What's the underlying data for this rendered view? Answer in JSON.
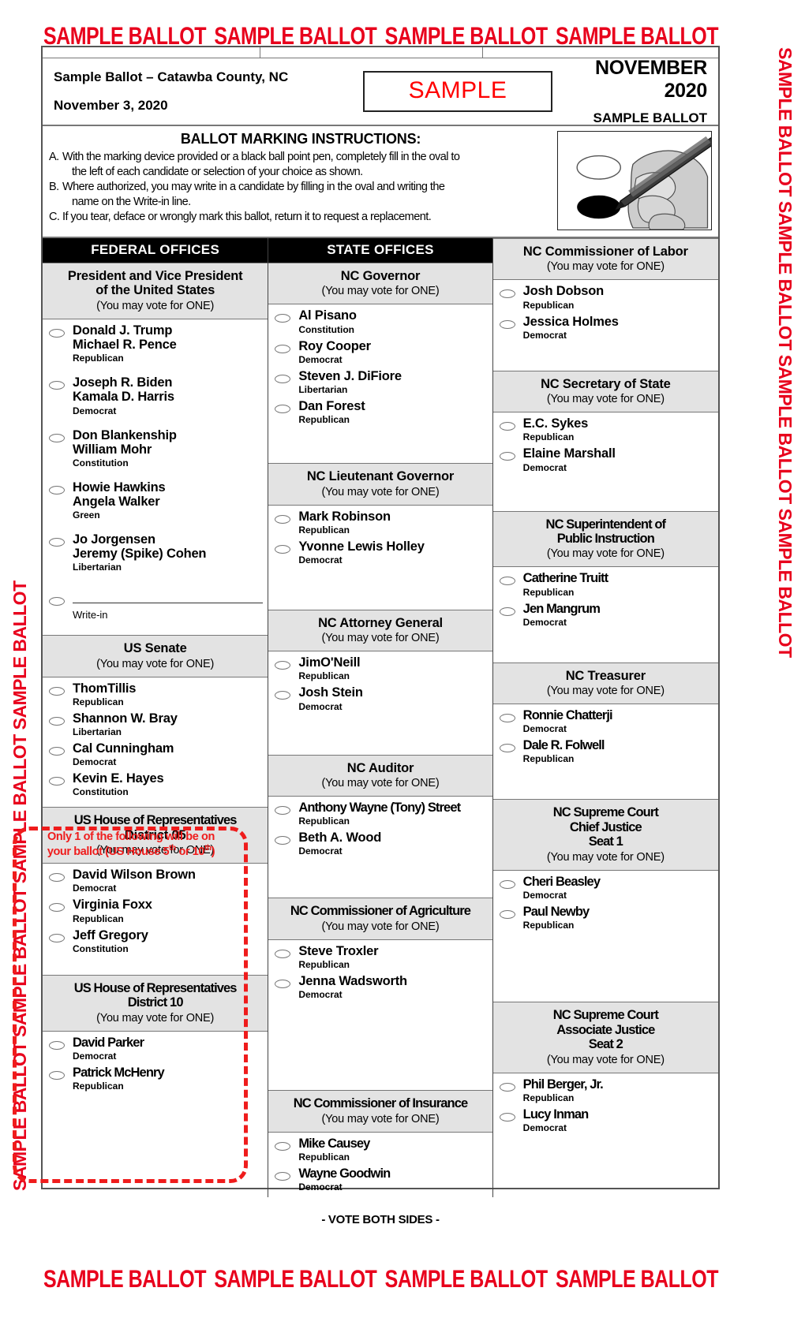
{
  "watermark": {
    "text": "SAMPLE BALLOT",
    "top_repeats": 4,
    "bottom_repeats": 4,
    "side_left": "SAMPLE BALLOT SAMPLE BALLOT SAMPLE BALLOT SAMPLE BALLOT",
    "side_right": "SAMPLE BALLOT SAMPLE BALLOT SAMPLE BALLOT SAMPLE BALLOT",
    "color": "#e8001c"
  },
  "header": {
    "title": "Sample Ballot – Catawba County, NC",
    "date": "November 3, 2020",
    "stamp": "SAMPLE",
    "stamp_color": "#ff0000",
    "right_month": "NOVEMBER 2020",
    "right_sub": "SAMPLE BALLOT"
  },
  "instructions": {
    "title": "BALLOT MARKING INSTRUCTIONS:",
    "items": [
      {
        "label": "A.",
        "line1": "With the marking device provided or a black ball point pen, completely fill in the oval to",
        "line2": "the left of each candidate or selection of your choice as shown."
      },
      {
        "label": "B.",
        "line1": "Where authorized, you may write in a candidate by filling in the oval and writing the",
        "line2": "name on the Write-in line."
      },
      {
        "label": "C.",
        "line1": "If you tear, deface or wrongly mark this ballot, return it to request a replacement.",
        "line2": ""
      }
    ],
    "image_name": "hand-marking-oval-illustration"
  },
  "callout": {
    "line1": "Only 1 of the following will be on",
    "line2_a": "your ballot (US House 5",
    "line2_sup1": "th",
    "line2_b": " or 10",
    "line2_sup2": "th",
    "line2_c": ")",
    "color": "#ef1c1c"
  },
  "footer": {
    "vote_both_sides": "- VOTE BOTH SIDES -"
  },
  "columns": [
    {
      "heading": "FEDERAL OFFICES",
      "contests": [
        {
          "title_lines": [
            "President and Vice President",
            "of the United States"
          ],
          "subtitle": "(You may vote for ONE)",
          "candidates": [
            {
              "name_lines": [
                "Donald J. Trump",
                "Michael R. Pence"
              ],
              "party": "Republican"
            },
            {
              "name_lines": [
                "Joseph R. Biden",
                "Kamala D. Harris"
              ],
              "party": "Democrat"
            },
            {
              "name_lines": [
                "Don Blankenship",
                "William Mohr"
              ],
              "party": "Constitution"
            },
            {
              "name_lines": [
                "Howie Hawkins",
                "Angela Walker"
              ],
              "party": "Green"
            },
            {
              "name_lines": [
                "Jo Jorgensen",
                "Jeremy (Spike) Cohen"
              ],
              "party": "Libertarian"
            }
          ],
          "write_in_label": "Write-in"
        },
        {
          "title_lines": [
            "US Senate"
          ],
          "subtitle": "(You may vote for ONE)",
          "candidates": [
            {
              "name_lines": [
                "ThomTillis"
              ],
              "party": "Republican"
            },
            {
              "name_lines": [
                "Shannon W. Bray"
              ],
              "party": "Libertarian"
            },
            {
              "name_lines": [
                "Cal Cunningham"
              ],
              "party": "Democrat"
            },
            {
              "name_lines": [
                "Kevin E. Hayes"
              ],
              "party": "Constitution"
            }
          ]
        },
        {
          "title_lines": [
            "US House of Representatives",
            "District 05"
          ],
          "subtitle": "(You may vote for ONE)",
          "candidates": [
            {
              "name_lines": [
                "David Wilson Brown"
              ],
              "party": "Democrat"
            },
            {
              "name_lines": [
                "Virginia Foxx"
              ],
              "party": "Republican"
            },
            {
              "name_lines": [
                "Jeff Gregory"
              ],
              "party": "Constitution"
            }
          ]
        },
        {
          "title_lines": [
            "US House of Representatives",
            "District 10"
          ],
          "subtitle": "(You may vote for ONE)",
          "candidates": [
            {
              "name_lines": [
                "David Parker"
              ],
              "party": "Democrat"
            },
            {
              "name_lines": [
                "Patrick McHenry"
              ],
              "party": "Republican"
            }
          ]
        }
      ]
    },
    {
      "heading": "STATE OFFICES",
      "contests": [
        {
          "title_lines": [
            "NC Governor"
          ],
          "subtitle": "(You may vote for ONE)",
          "candidates": [
            {
              "name_lines": [
                "Al Pisano"
              ],
              "party": "Constitution"
            },
            {
              "name_lines": [
                "Roy Cooper"
              ],
              "party": "Democrat"
            },
            {
              "name_lines": [
                "Steven J. DiFiore"
              ],
              "party": "Libertarian"
            },
            {
              "name_lines": [
                "Dan Forest"
              ],
              "party": "Republican"
            }
          ]
        },
        {
          "title_lines": [
            "NC Lieutenant Governor"
          ],
          "subtitle": "(You may vote for ONE)",
          "candidates": [
            {
              "name_lines": [
                "Mark Robinson"
              ],
              "party": "Republican"
            },
            {
              "name_lines": [
                "Yvonne Lewis Holley"
              ],
              "party": "Democrat"
            }
          ]
        },
        {
          "title_lines": [
            "NC Attorney General"
          ],
          "subtitle": "(You may vote for ONE)",
          "candidates": [
            {
              "name_lines": [
                "JimO'Neill"
              ],
              "party": "Republican"
            },
            {
              "name_lines": [
                "Josh Stein"
              ],
              "party": "Democrat"
            }
          ]
        },
        {
          "title_lines": [
            "NC Auditor"
          ],
          "subtitle": "(You may vote for ONE)",
          "candidates": [
            {
              "name_lines": [
                "Anthony Wayne (Tony) Street"
              ],
              "party": "Republican"
            },
            {
              "name_lines": [
                "Beth A. Wood"
              ],
              "party": "Democrat"
            }
          ]
        },
        {
          "title_lines": [
            "NC Commissioner of Agriculture"
          ],
          "subtitle": "(You may vote for ONE)",
          "candidates": [
            {
              "name_lines": [
                "Steve Troxler"
              ],
              "party": "Republican"
            },
            {
              "name_lines": [
                "Jenna Wadsworth"
              ],
              "party": "Democrat"
            }
          ]
        },
        {
          "title_lines": [
            "NC Commissioner of Insurance"
          ],
          "subtitle": "(You may vote for ONE)",
          "candidates": [
            {
              "name_lines": [
                "Mike Causey"
              ],
              "party": "Republican"
            },
            {
              "name_lines": [
                "Wayne Goodwin"
              ],
              "party": "Democrat"
            }
          ]
        }
      ]
    },
    {
      "heading": "",
      "contests": [
        {
          "title_lines": [
            "NC Commissioner of Labor"
          ],
          "subtitle": "(You may vote for ONE)",
          "candidates": [
            {
              "name_lines": [
                "Josh Dobson"
              ],
              "party": "Republican"
            },
            {
              "name_lines": [
                "Jessica Holmes"
              ],
              "party": "Democrat"
            }
          ]
        },
        {
          "title_lines": [
            "NC Secretary of State"
          ],
          "subtitle": "(You may vote for ONE)",
          "candidates": [
            {
              "name_lines": [
                "E.C. Sykes"
              ],
              "party": "Republican"
            },
            {
              "name_lines": [
                "Elaine Marshall"
              ],
              "party": "Democrat"
            }
          ]
        },
        {
          "title_lines": [
            "NC Superintendent of",
            "Public Instruction"
          ],
          "subtitle": "(You may vote for ONE)",
          "candidates": [
            {
              "name_lines": [
                "Catherine Truitt"
              ],
              "party": "Republican"
            },
            {
              "name_lines": [
                "Jen Mangrum"
              ],
              "party": "Democrat"
            }
          ]
        },
        {
          "title_lines": [
            "NC Treasurer"
          ],
          "subtitle": "(You may vote for ONE)",
          "candidates": [
            {
              "name_lines": [
                "Ronnie Chatterji"
              ],
              "party": "Democrat"
            },
            {
              "name_lines": [
                "Dale R. Folwell"
              ],
              "party": "Republican"
            }
          ]
        },
        {
          "title_lines": [
            "NC Supreme Court",
            "Chief Justice",
            "Seat 1"
          ],
          "subtitle": "(You may vote for ONE)",
          "candidates": [
            {
              "name_lines": [
                "Cheri Beasley"
              ],
              "party": "Democrat"
            },
            {
              "name_lines": [
                "Paul Newby"
              ],
              "party": "Republican"
            }
          ]
        },
        {
          "title_lines": [
            "NC Supreme Court",
            "Associate Justice",
            "Seat 2"
          ],
          "subtitle": "(You may vote for ONE)",
          "candidates": [
            {
              "name_lines": [
                "Phil Berger, Jr."
              ],
              "party": "Republican"
            },
            {
              "name_lines": [
                "Lucy Inman"
              ],
              "party": "Democrat"
            }
          ]
        }
      ]
    }
  ]
}
